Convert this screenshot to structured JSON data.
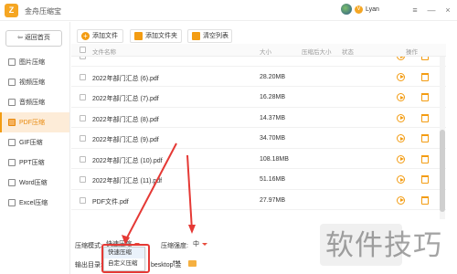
{
  "app": {
    "title": "金舟压缩宝",
    "logo_char": "Z"
  },
  "user": {
    "name": "Lyan",
    "badge": "V"
  },
  "window": {
    "menu": "≡",
    "minimize": "—",
    "close": "×"
  },
  "sidebar": {
    "back_label": "返回首页",
    "items": [
      {
        "label": "图片压缩"
      },
      {
        "label": "视频压缩"
      },
      {
        "label": "音频压缩"
      },
      {
        "label": "PDF压缩",
        "active": true
      },
      {
        "label": "GIF压缩"
      },
      {
        "label": "PPT压缩"
      },
      {
        "label": "Word压缩"
      },
      {
        "label": "Excel压缩"
      }
    ]
  },
  "toolbar": {
    "add_file": "添加文件",
    "add_folder": "添加文件夹",
    "clear_list": "清空列表"
  },
  "table": {
    "headers": {
      "name": "文件名称",
      "size": "大小",
      "compressed_size": "压缩后大小",
      "status": "状态",
      "action": "操作"
    },
    "rows": [
      {
        "name": "",
        "size": ""
      },
      {
        "name": "2022年部门汇总 (6).pdf",
        "size": "28.20MB"
      },
      {
        "name": "2022年部门汇总 (7).pdf",
        "size": "16.28MB"
      },
      {
        "name": "2022年部门汇总 (8).pdf",
        "size": "14.37MB"
      },
      {
        "name": "2022年部门汇总 (9).pdf",
        "size": "34.70MB"
      },
      {
        "name": "2022年部门汇总 (10).pdf",
        "size": "108.18MB"
      },
      {
        "name": "2022年部门汇总 (11).pdf",
        "size": "51.16MB"
      },
      {
        "name": "PDF文件.pdf",
        "size": "27.97MB"
      }
    ]
  },
  "settings": {
    "mode_label": "压缩模式:",
    "mode_value": "快速压缩",
    "strength_label": "压缩强度:",
    "strength_value": "中",
    "output_label": "输出目录:",
    "output_path": "besktop\\金",
    "more": "•••",
    "mode_options": [
      "快速压缩",
      "自定义压缩"
    ]
  },
  "watermark": "软件技巧",
  "colors": {
    "accent": "#f39c12",
    "highlight_box": "#e53935",
    "arrow": "#e53935"
  }
}
